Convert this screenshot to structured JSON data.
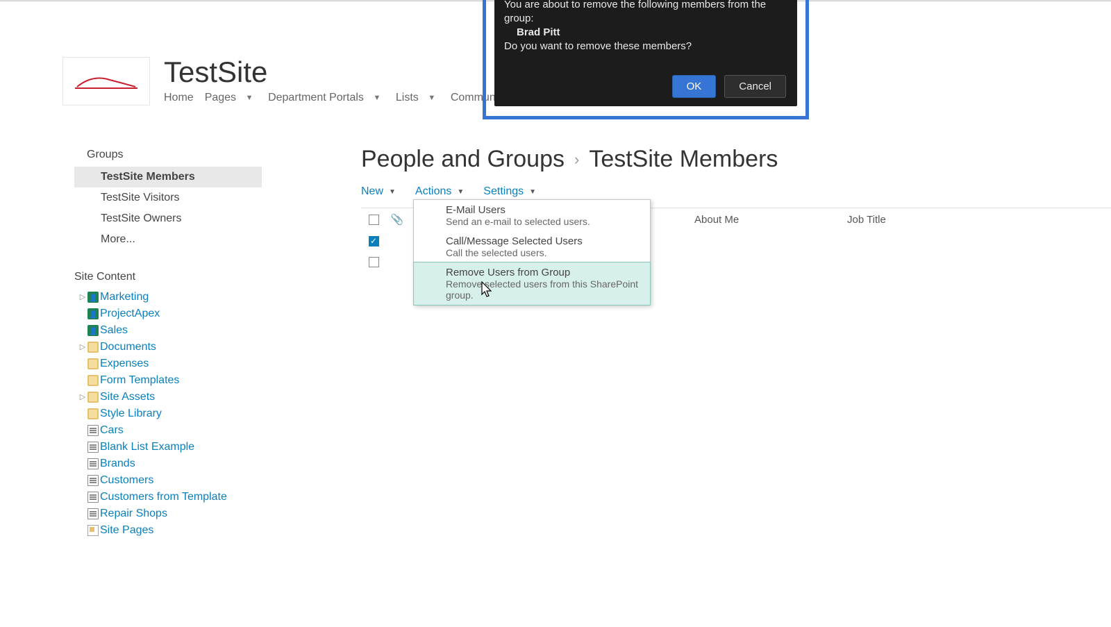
{
  "site_title": "TestSite",
  "top_nav": [
    {
      "label": "Home",
      "has_dropdown": false
    },
    {
      "label": "Pages",
      "has_dropdown": true
    },
    {
      "label": "Department Portals",
      "has_dropdown": true
    },
    {
      "label": "Lists",
      "has_dropdown": true
    },
    {
      "label": "Communicati",
      "has_dropdown": false
    }
  ],
  "sidebar": {
    "groups_heading": "Groups",
    "groups": [
      {
        "label": "TestSite Members",
        "selected": true
      },
      {
        "label": "TestSite Visitors",
        "selected": false
      },
      {
        "label": "TestSite Owners",
        "selected": false
      },
      {
        "label": "More...",
        "selected": false
      }
    ],
    "site_content_heading": "Site Content",
    "tree": [
      {
        "label": "Marketing",
        "icon": "people",
        "expandable": true
      },
      {
        "label": "ProjectApex",
        "icon": "people",
        "expandable": true
      },
      {
        "label": "Sales",
        "icon": "people",
        "expandable": true
      },
      {
        "label": "Documents",
        "icon": "folder",
        "expandable": true
      },
      {
        "label": "Expenses",
        "icon": "folder",
        "expandable": false
      },
      {
        "label": "Form Templates",
        "icon": "folder",
        "expandable": false
      },
      {
        "label": "Site Assets",
        "icon": "folder",
        "expandable": true
      },
      {
        "label": "Style Library",
        "icon": "folder",
        "expandable": false
      },
      {
        "label": "Cars",
        "icon": "list",
        "expandable": false
      },
      {
        "label": "Blank List Example",
        "icon": "list",
        "expandable": false
      },
      {
        "label": "Brands",
        "icon": "list",
        "expandable": false
      },
      {
        "label": "Customers",
        "icon": "list",
        "expandable": false
      },
      {
        "label": "Customers from Template",
        "icon": "list",
        "expandable": false
      },
      {
        "label": "Repair Shops",
        "icon": "list",
        "expandable": false
      },
      {
        "label": "Site Pages",
        "icon": "page",
        "expandable": false
      }
    ]
  },
  "breadcrumb": {
    "parent": "People and Groups",
    "current": "TestSite Members"
  },
  "toolbar": {
    "new_label": "New",
    "actions_label": "Actions",
    "settings_label": "Settings"
  },
  "columns": {
    "about": "About Me",
    "job": "Job Title"
  },
  "rows": [
    {
      "checked": true
    },
    {
      "checked": false
    }
  ],
  "actions_menu": [
    {
      "title": "E-Mail Users",
      "desc": "Send an e-mail to selected users."
    },
    {
      "title": "Call/Message Selected Users",
      "desc": "Call the selected users."
    },
    {
      "title": "Remove Users from Group",
      "desc": "Remove selected users from this SharePoint group."
    }
  ],
  "dialog": {
    "line1": "You are about to remove the following members from the group:",
    "member": "Brad Pitt",
    "line2": "Do you want to remove these members?",
    "ok": "OK",
    "cancel": "Cancel"
  }
}
